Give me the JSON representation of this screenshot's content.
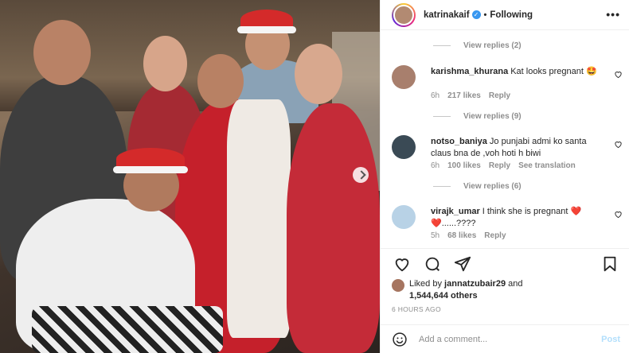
{
  "post": {
    "username": "katrinakaif",
    "verified_mark": "✓",
    "separator": "•",
    "follow_status": "Following",
    "more_icon": "more-horizontal-icon"
  },
  "comments": [
    {
      "view_replies": "View replies (2)"
    },
    {
      "username": "karishma_khurana",
      "text": "Kat looks pregnant 🤩",
      "age": "6h",
      "likes": "217 likes",
      "reply": "Reply",
      "view_replies": "View replies (9)"
    },
    {
      "username": "notso_baniya",
      "text": "Jo punjabi admi ko santa claus bna de ,voh hoti h biwi",
      "age": "6h",
      "likes": "100 likes",
      "reply": "Reply",
      "translation": "See translation",
      "view_replies": "View replies (6)"
    },
    {
      "username": "virajk_umar",
      "text": "I think she is pregnant ❤️❤️......????",
      "age": "5h",
      "likes": "68 likes",
      "reply": "Reply"
    }
  ],
  "likes": {
    "prefix": "Liked by",
    "user": "jannatzubair29",
    "and": "and",
    "others": "1,544,644 others"
  },
  "timestamp": "6 HOURS AGO",
  "add_comment": {
    "placeholder": "Add a comment...",
    "post_label": "Post"
  },
  "colors": {
    "link_blue": "#3897f0",
    "post_disabled": "#b2dffc",
    "muted": "#8e8e8e"
  }
}
